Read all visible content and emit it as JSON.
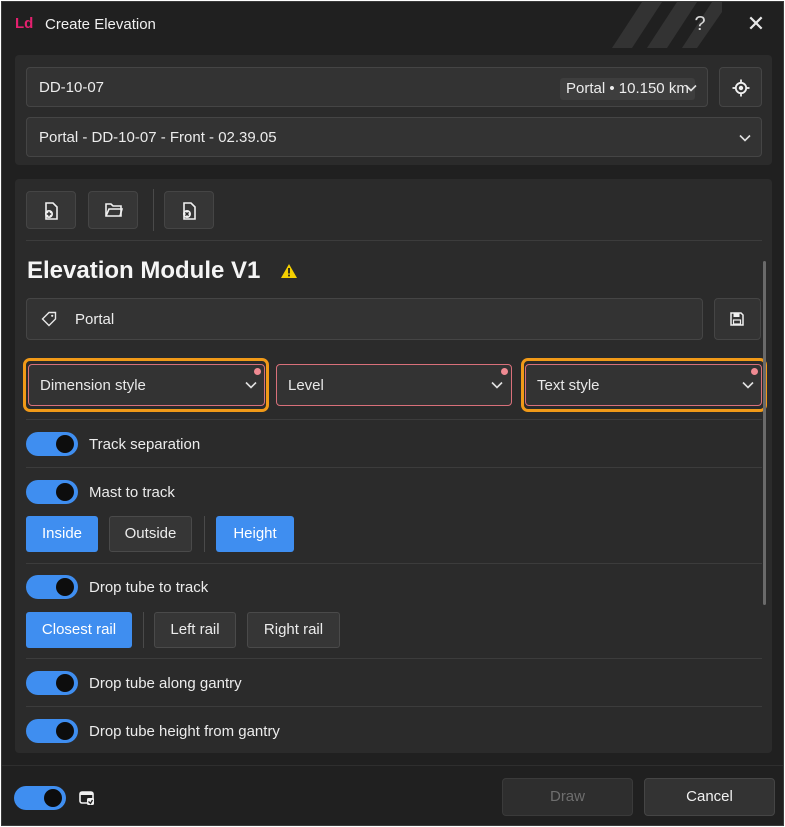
{
  "window": {
    "logo": "Ld",
    "title": "Create Elevation",
    "help_glyph": "?",
    "close_glyph": "✕"
  },
  "top": {
    "location_value": "DD-10-07",
    "location_badge": "Portal • 10.150 km",
    "elevation_select": "Portal - DD-10-07 - Front - 02.39.05"
  },
  "module": {
    "title": "Elevation Module V1",
    "tag_value": "Portal",
    "dropdowns": [
      {
        "label": "Dimension style",
        "highlighted": true
      },
      {
        "label": "Level",
        "highlighted": false
      },
      {
        "label": "Text style",
        "highlighted": true
      }
    ],
    "options": {
      "track_separation": {
        "label": "Track separation",
        "on": true
      },
      "mast_to_track": {
        "label": "Mast to track",
        "on": true,
        "buttons": [
          "Inside",
          "Outside",
          "Height"
        ],
        "active": [
          "Inside",
          "Height"
        ]
      },
      "drop_tube_to_track": {
        "label": "Drop tube to track",
        "on": true,
        "buttons": [
          "Closest rail",
          "Left rail",
          "Right rail"
        ],
        "active": [
          "Closest rail"
        ]
      },
      "drop_tube_along_gantry": {
        "label": "Drop tube along gantry",
        "on": true
      },
      "drop_tube_height_from_gantry": {
        "label": "Drop tube height from gantry",
        "on": true
      }
    }
  },
  "footer": {
    "toggle_on": true,
    "draw_label": "Draw",
    "cancel_label": "Cancel"
  },
  "colors": {
    "accent": "#3f8ef0",
    "logo": "#e3206e",
    "highlight": "#f19a18",
    "warning": "#f5d000",
    "required_dot": "#f08a92"
  }
}
